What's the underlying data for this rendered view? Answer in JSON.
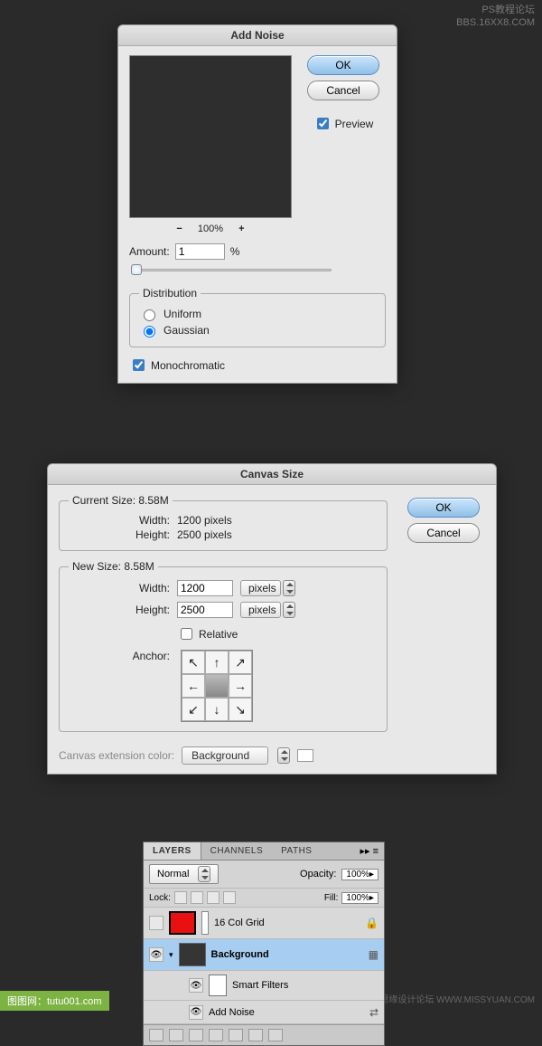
{
  "watermarks": {
    "top_right_line1": "PS教程论坛",
    "top_right_line2": "BBS.16XX8.COM",
    "bottom_right": "思缘设计论坛    WWW.MISSYUAN.COM",
    "bottom_left": "图图网：tutu001.com"
  },
  "add_noise": {
    "title": "Add Noise",
    "ok": "OK",
    "cancel": "Cancel",
    "preview_label": "Preview",
    "preview_checked": true,
    "zoom_value": "100%",
    "amount_label": "Amount:",
    "amount_value": "1",
    "amount_unit": "%",
    "distribution_legend": "Distribution",
    "uniform_label": "Uniform",
    "gaussian_label": "Gaussian",
    "distribution_selected": "gaussian",
    "monochromatic_label": "Monochromatic",
    "monochromatic_checked": true
  },
  "canvas_size": {
    "title": "Canvas Size",
    "ok": "OK",
    "cancel": "Cancel",
    "current_legend": "Current Size: 8.58M",
    "current_width_label": "Width:",
    "current_width_value": "1200 pixels",
    "current_height_label": "Height:",
    "current_height_value": "2500 pixels",
    "new_legend": "New Size: 8.58M",
    "new_width_label": "Width:",
    "new_width_value": "1200",
    "new_height_label": "Height:",
    "new_height_value": "2500",
    "unit": "pixels",
    "relative_label": "Relative",
    "relative_checked": false,
    "anchor_label": "Anchor:",
    "ext_label": "Canvas extension color:",
    "ext_value": "Background"
  },
  "layers_panel": {
    "tabs": {
      "layers": "LAYERS",
      "channels": "CHANNELS",
      "paths": "PATHS"
    },
    "blend_mode": "Normal",
    "opacity_label": "Opacity:",
    "opacity_value": "100%",
    "lock_label": "Lock:",
    "fill_label": "Fill:",
    "fill_value": "100%",
    "layers": [
      {
        "name": "16 Col Grid",
        "visible": false,
        "locked": true
      },
      {
        "name": "Background",
        "visible": true,
        "selected": true,
        "bold": true
      }
    ],
    "smart_filters_label": "Smart Filters",
    "add_noise_filter": "Add Noise"
  }
}
